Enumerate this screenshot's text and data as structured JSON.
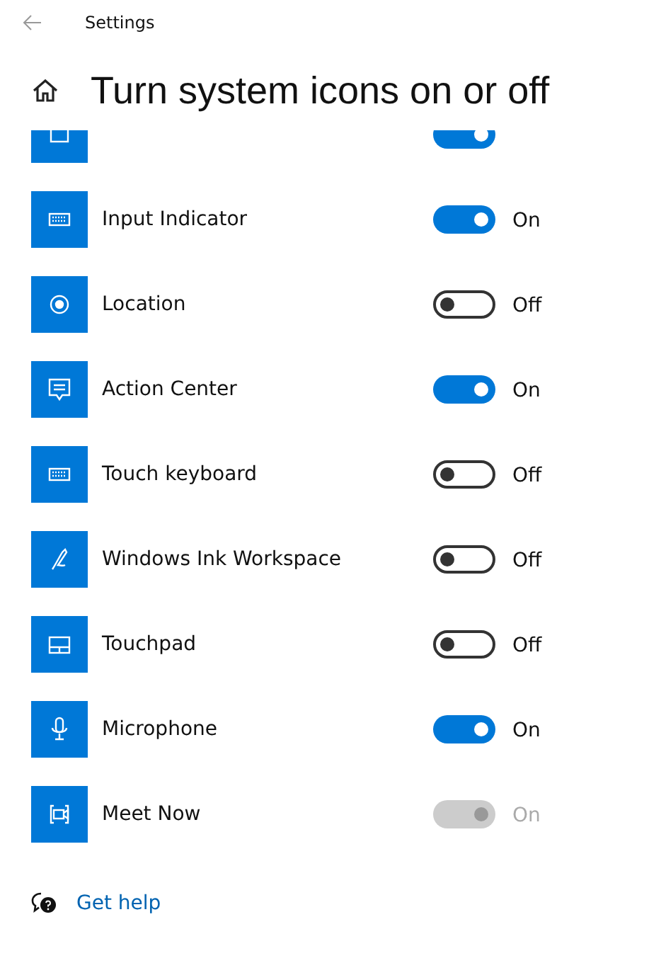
{
  "window": {
    "title": "Settings"
  },
  "page_title": "Turn system icons on or off",
  "items": [
    {
      "kind": "clipped",
      "on": true,
      "disabled": false
    },
    {
      "kind": "row",
      "label": "Input Indicator",
      "on": true,
      "disabled": false,
      "state_text": "On"
    },
    {
      "kind": "row",
      "label": "Location",
      "on": false,
      "disabled": false,
      "state_text": "Off"
    },
    {
      "kind": "row",
      "label": "Action Center",
      "on": true,
      "disabled": false,
      "state_text": "On"
    },
    {
      "kind": "row",
      "label": "Touch keyboard",
      "on": false,
      "disabled": false,
      "state_text": "Off"
    },
    {
      "kind": "row",
      "label": "Windows Ink Workspace",
      "on": false,
      "disabled": false,
      "state_text": "Off"
    },
    {
      "kind": "row",
      "label": "Touchpad",
      "on": false,
      "disabled": false,
      "state_text": "Off"
    },
    {
      "kind": "row",
      "label": "Microphone",
      "on": true,
      "disabled": false,
      "state_text": "On"
    },
    {
      "kind": "row",
      "label": "Meet Now",
      "on": true,
      "disabled": true,
      "state_text": "On"
    }
  ],
  "help_link": "Get help"
}
